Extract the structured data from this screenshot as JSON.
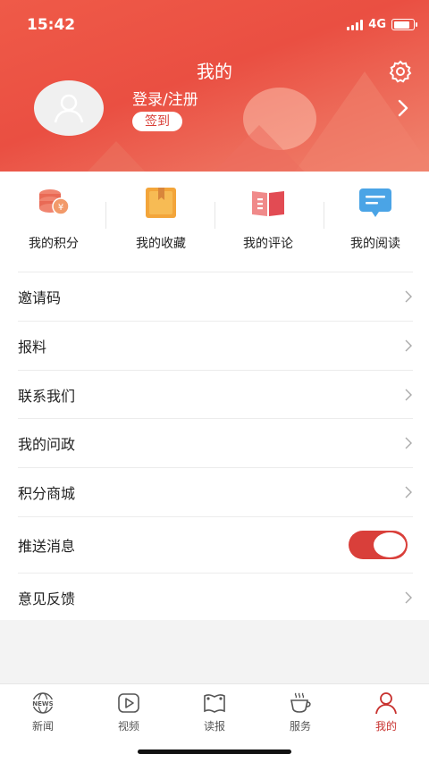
{
  "status_bar": {
    "time": "15:42",
    "network": "4G",
    "battery_level": 0.85
  },
  "header": {
    "title": "我的",
    "login_text": "登录/注册",
    "signin_label": "签到"
  },
  "quick_links": [
    {
      "label": "我的积分",
      "icon": "points-coin-icon"
    },
    {
      "label": "我的收藏",
      "icon": "bookmark-book-icon"
    },
    {
      "label": "我的评论",
      "icon": "open-book-icon"
    },
    {
      "label": "我的阅读",
      "icon": "chat-message-icon"
    }
  ],
  "menu": [
    {
      "label": "邀请码",
      "type": "link"
    },
    {
      "label": "报料",
      "type": "link"
    },
    {
      "label": "联系我们",
      "type": "link"
    },
    {
      "label": "我的问政",
      "type": "link"
    },
    {
      "label": "积分商城",
      "type": "link"
    },
    {
      "label": "推送消息",
      "type": "toggle",
      "enabled": true
    },
    {
      "label": "意见反馈",
      "type": "link"
    }
  ],
  "tabs": [
    {
      "label": "新闻",
      "icon": "globe-news-icon",
      "active": false
    },
    {
      "label": "视频",
      "icon": "play-video-icon",
      "active": false
    },
    {
      "label": "读报",
      "icon": "newspaper-icon",
      "active": false
    },
    {
      "label": "服务",
      "icon": "coffee-cup-icon",
      "active": false
    },
    {
      "label": "我的",
      "icon": "person-icon",
      "active": true
    }
  ],
  "colors": {
    "accent": "#d93f3a",
    "header_bg": "#ea5142",
    "active_tab": "#c8322f"
  }
}
